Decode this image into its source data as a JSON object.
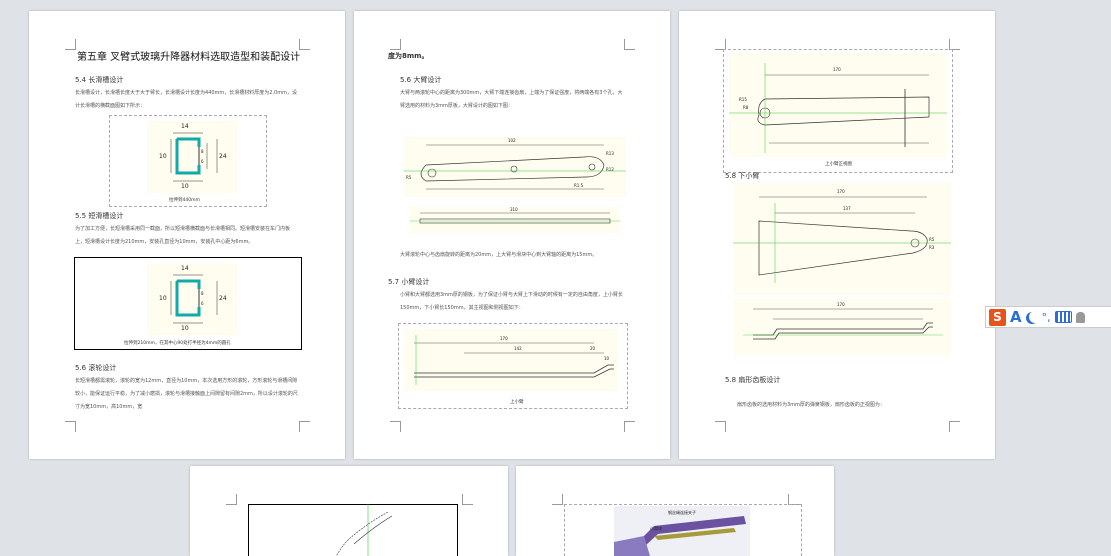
{
  "heading_marker": "H",
  "page1": {
    "chapter_title": "第五章 叉臂式玻璃升降器材料选取造型和装配设计",
    "sec_5_4": "5.4 长滑槽设计",
    "p_5_4": "长滑槽设计，长滑槽长度大于大于臂长，长滑槽设计长度为440mm，长滑槽材料厚度为2.0mm，设计长滑槽的横截面图如下所示：",
    "cap_5_4": "拉伸到440mm",
    "dims_a": [
      "14",
      "10",
      "10",
      "8",
      "6",
      "24"
    ],
    "sec_5_5": "5.5 短滑槽设计",
    "p_5_5": "为了加工方便，长短滑槽采用同一截面，所以短滑槽横截面与长滑槽相同。短滑槽安装在车门内板上，短滑槽设计长度为210mm，安装孔直径为10mm，安装孔中心距为6mm。",
    "cap_5_5": "拉伸到210mm，在其中心90处打半径为4mm的圆孔",
    "dims_b": [
      "14",
      "10",
      "10",
      "8",
      "6",
      "24"
    ],
    "sec_5_6": "5.6 滚轮设计",
    "p_5_6": "长短滑槽都需滚轮，滚轮的宽为12mm，直径为10mm，本次选用方形的滚轮，方形滚轮与滑槽间隙较小，能保证运行平稳，为了减小磨损，滚轮与滑槽接触面上间隙留有间隙2mm，所以设计滚轮的尺寸为宽10mm，高10mm，宽"
  },
  "page2": {
    "top_line": "度为8mm。",
    "sec_5_6b": "5.6 大臂设计",
    "p_5_6b": "大臂与两滚轮中心的距离为300mm，大臂下端连接齿扇，上端为了保证强度，将两端各有3个孔，大臂选用的材料为3mm厚板，大臂设计的图如下图：",
    "p_after": "大臂滚轮中心与齿扇旋转的距离为20mm，上大臂与滑块中心到大臂轴的距离为15mm。",
    "sec_5_7": "5.7 小臂设计",
    "p_5_7": "小臂和大臂都选用3mm厚的钢板，为了保证小臂与大臂上下滑动的时候有一定的自由角度，上小臂长150mm，下小臂长150mm，其主视图和侧视图如下：",
    "cap": "上小臂",
    "dims_top": [
      "102",
      "R13",
      "R12",
      "R5",
      "R1.5"
    ],
    "dim_mid": "310",
    "dims_bottom": [
      "170",
      "142",
      "20",
      "10"
    ]
  },
  "page3": {
    "cap_top": "上小臂正视图",
    "sec_5_8": "5.8 下小臂",
    "sec_5_8b": "5.8 扇形齿板设计",
    "p_5_8b": "扇形齿板的选用材料为3mm厚的弹簧钢板，扇形齿板的正视图为：",
    "dims_top": [
      "170",
      "R15",
      "R8"
    ],
    "dims_mid": [
      "170",
      "137",
      "R5",
      "R3"
    ],
    "dim_bot": "170"
  },
  "page5": {
    "labels": [
      "钢丝绳连接夹子",
      "小滑块"
    ]
  },
  "toolbar": {
    "s": "S",
    "a": "A",
    "punct": "°,"
  },
  "colors": {
    "bg": "#dfe3e8",
    "accent": "#2a6ed3",
    "sogou": "#e8531b"
  }
}
